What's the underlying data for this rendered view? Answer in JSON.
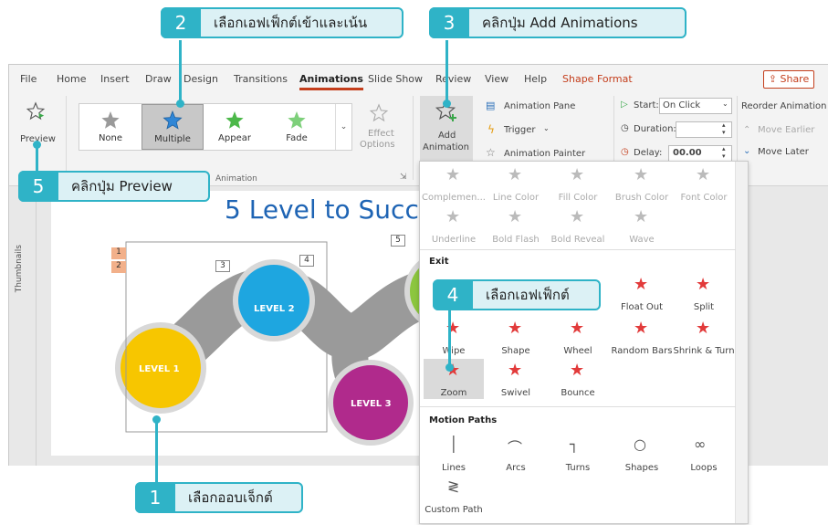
{
  "menu": {
    "items": [
      "File",
      "Home",
      "Insert",
      "Draw",
      "Design",
      "Transitions",
      "Animations",
      "Slide Show",
      "Review",
      "View",
      "Help",
      "Shape Format"
    ],
    "share": "Share"
  },
  "ribbon": {
    "preview": "Preview",
    "gallery": [
      {
        "label": "None"
      },
      {
        "label": "Multiple"
      },
      {
        "label": "Appear"
      },
      {
        "label": "Fade"
      }
    ],
    "effect_options": [
      "Effect",
      "Options"
    ],
    "group_animation": "Animation",
    "add_animation": [
      "Add",
      "Animation"
    ],
    "animation_pane": "Animation Pane",
    "trigger": "Trigger",
    "animation_painter": "Animation Painter",
    "start_label": "Start:",
    "start_value": "On Click",
    "duration_label": "Duration:",
    "delay_label": "Delay:",
    "delay_value": "00.00",
    "reorder": "Reorder Animation",
    "move_earlier": "Move Earlier",
    "move_later": "Move Later"
  },
  "thumbnails_label": "Thumbnails",
  "slide": {
    "title": "5 Level to Succ",
    "levels": [
      "LEVEL 1",
      "LEVEL 2",
      "LEVEL 3"
    ],
    "tags": [
      "1",
      "2",
      "3",
      "4",
      "5"
    ]
  },
  "panel": {
    "emphasis_row1": [
      "Complemen...",
      "Line Color",
      "Fill Color",
      "Brush Color",
      "Font Color"
    ],
    "emphasis_row2": [
      "Underline",
      "Bold Flash",
      "Bold Reveal",
      "Wave"
    ],
    "exit_title": "Exit",
    "exit_row1": [
      "Float Out",
      "Split"
    ],
    "exit_row2": [
      "Wipe",
      "Shape",
      "Wheel",
      "Random Bars",
      "Shrink & Turn"
    ],
    "exit_row3": [
      "Zoom",
      "Swivel",
      "Bounce"
    ],
    "motion_title": "Motion Paths",
    "motion_row1": [
      "Lines",
      "Arcs",
      "Turns",
      "Shapes",
      "Loops"
    ],
    "motion_row2": [
      "Custom Path"
    ]
  },
  "callouts": {
    "c1": {
      "num": "1",
      "text": "เลือกออบเจ็กต์"
    },
    "c2": {
      "num": "2",
      "text": "เลือกเอฟเฟ็กต์เข้าและเน้น"
    },
    "c3": {
      "num": "3",
      "text": "คลิกปุ่ม Add Animations"
    },
    "c4": {
      "num": "4",
      "text": "เลือกเอฟเฟ็กต์"
    },
    "c5": {
      "num": "5",
      "text": "คลิกปุ่ม Preview"
    }
  },
  "colors": {
    "accent": "#c43e1c",
    "callout": "#2fb3c7",
    "callout_bg": "#dcf1f5",
    "level1": "#f7c600",
    "level2": "#1ea6e0",
    "level3": "#b02a8c",
    "level_green": "#8cc63f",
    "exit_star": "#e23b3b"
  }
}
